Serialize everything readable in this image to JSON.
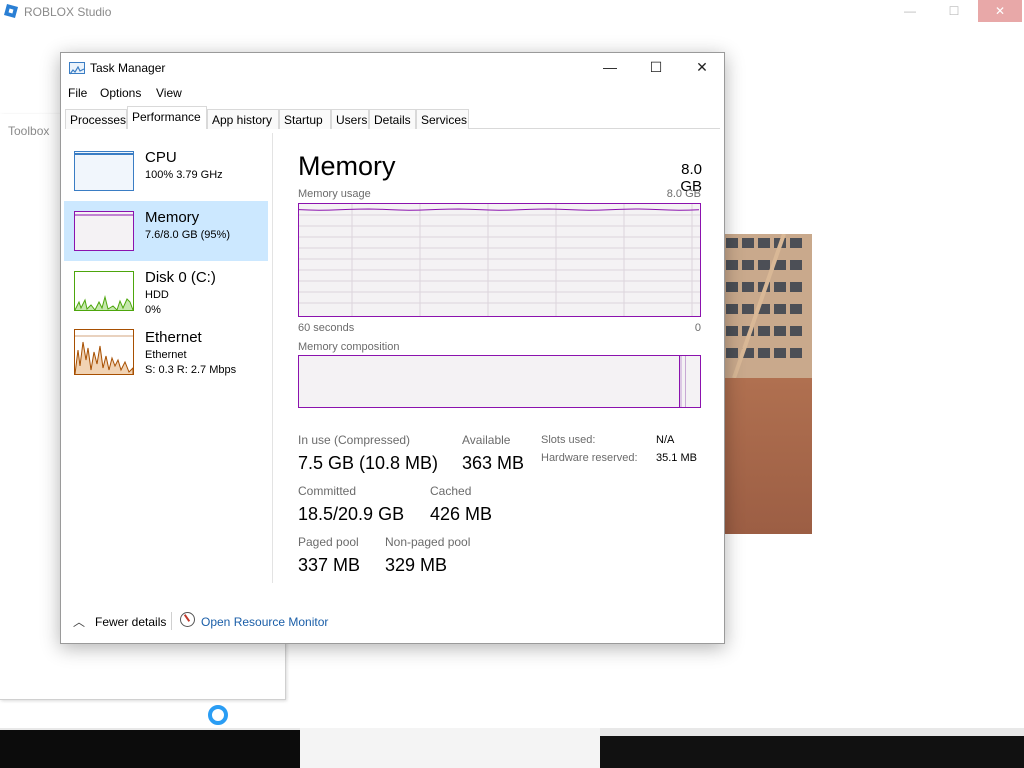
{
  "background_app": {
    "title": "ROBLOX Studio",
    "toolbox_label": "Toolbox",
    "controls": {
      "minimize": "—",
      "maximize": "☐",
      "close": "✕"
    }
  },
  "window": {
    "title": "Task Manager",
    "controls": {
      "minimize": "—",
      "maximize": "☐",
      "close": "✕"
    }
  },
  "menu": [
    "File",
    "Options",
    "View"
  ],
  "tabs": [
    "Processes",
    "Performance",
    "App history",
    "Startup",
    "Users",
    "Details",
    "Services"
  ],
  "active_tab": "Performance",
  "sidebar": [
    {
      "name": "CPU",
      "line1": "100%  3.79 GHz",
      "line2": "",
      "color": "#3a7dc4"
    },
    {
      "name": "Memory",
      "line1": "7.6/8.0 GB (95%)",
      "line2": "",
      "color": "#8b12ae"
    },
    {
      "name": "Disk 0 (C:)",
      "line1": "HDD",
      "line2": "0%",
      "color": "#4da60c"
    },
    {
      "name": "Ethernet",
      "line1": "Ethernet",
      "line2": "S: 0.3  R: 2.7 Mbps",
      "color": "#a74f01"
    }
  ],
  "main": {
    "title": "Memory",
    "total": "8.0 GB",
    "usage_label": "Memory usage",
    "usage_max": "8.0 GB",
    "axis_left": "60 seconds",
    "axis_right": "0",
    "composition_label": "Memory composition",
    "usage_fraction": 0.95,
    "stats": {
      "in_use_label": "In use (Compressed)",
      "in_use_value": "7.5 GB (10.8 MB)",
      "available_label": "Available",
      "available_value": "363 MB",
      "committed_label": "Committed",
      "committed_value": "18.5/20.9 GB",
      "cached_label": "Cached",
      "cached_value": "426 MB",
      "paged_label": "Paged pool",
      "paged_value": "337 MB",
      "nonpaged_label": "Non-paged pool",
      "nonpaged_value": "329 MB",
      "slots_label": "Slots used:",
      "slots_value": "N/A",
      "hwres_label": "Hardware reserved:",
      "hwres_value": "35.1 MB"
    }
  },
  "footer": {
    "fewer_details": "Fewer details",
    "open_resource_monitor": "Open Resource Monitor"
  },
  "colors": {
    "accent": "#8b12ae",
    "selection": "#cce8ff",
    "link": "#1a5ea8"
  }
}
